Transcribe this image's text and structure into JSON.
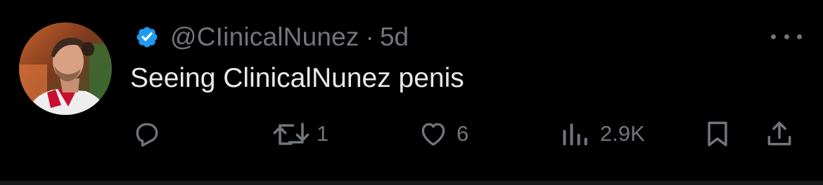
{
  "tweet": {
    "handle": "@CIinicalNunez",
    "separator": "·",
    "time": "5d",
    "text": "Seeing ClinicalNunez penis",
    "verified_color": "#1d9bf0"
  },
  "actions": {
    "reply": {
      "icon": "reply-icon",
      "count": ""
    },
    "retweet": {
      "icon": "retweet-icon",
      "count": "1"
    },
    "like": {
      "icon": "heart-icon",
      "count": "6"
    },
    "views": {
      "icon": "views-icon",
      "count": "2.9K"
    },
    "bookmark": {
      "icon": "bookmark-icon"
    },
    "share": {
      "icon": "share-icon"
    }
  },
  "colors": {
    "background": "#000000",
    "text": "#e7e9ea",
    "muted": "#71767b"
  }
}
